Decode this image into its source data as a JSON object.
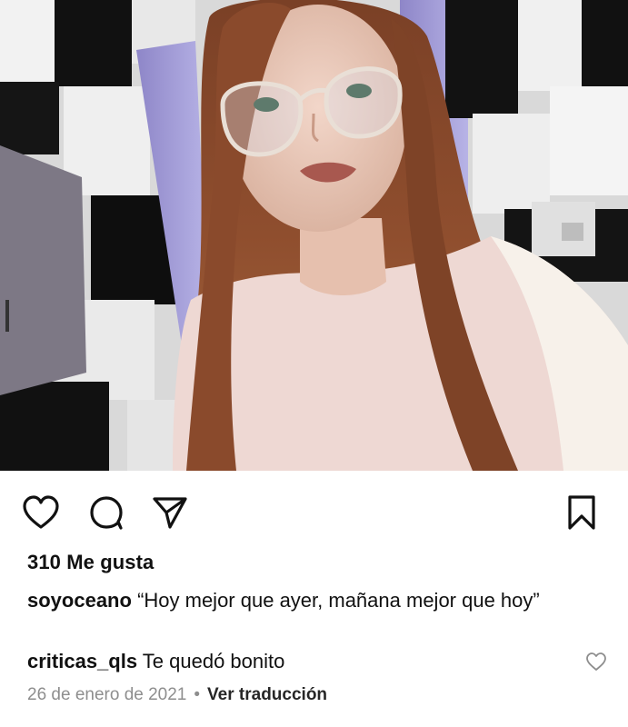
{
  "post": {
    "image_description_icon": "photo-selfie",
    "likes_text": "310 Me gusta",
    "caption": {
      "username": "soyoceano",
      "text": "“Hoy mejor que ayer, mañana mejor que hoy”"
    },
    "comment": {
      "username": "criticas_qls",
      "text": "Te quedó bonito"
    },
    "date": "26 de enero de 2021",
    "separator": "•",
    "translate_label": "Ver traducción"
  },
  "icons": {
    "like": "heart-icon",
    "comment": "comment-bubble-icon",
    "share": "paper-plane-icon",
    "save": "bookmark-icon",
    "comment_like": "small-heart-icon"
  },
  "colors": {
    "text": "#111111",
    "muted": "#8e8e8e",
    "background": "#ffffff"
  }
}
